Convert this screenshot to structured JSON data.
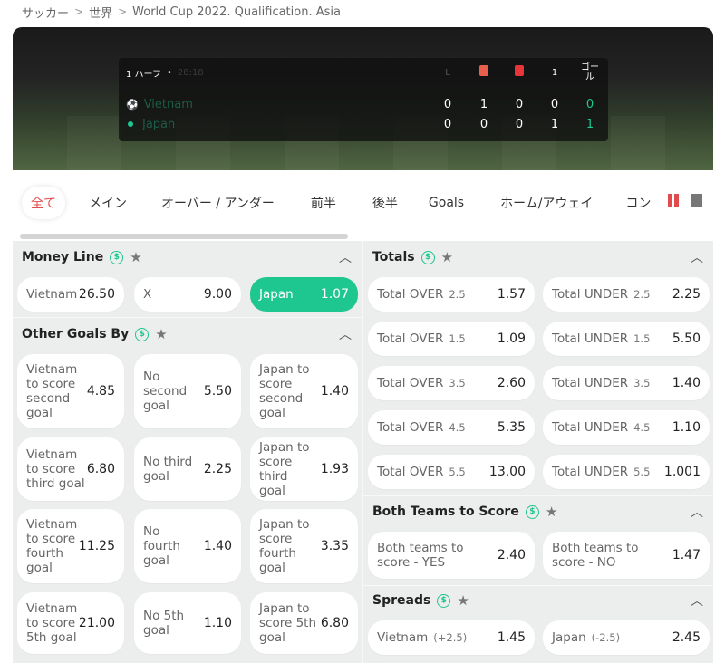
{
  "breadcrumb": [
    "サッカー",
    "世界",
    "World Cup 2022. Qualification. Asia"
  ],
  "scoreboard": {
    "period": "1 ハーフ",
    "time": "28:18",
    "headers": {
      "corners": "L",
      "goals_label": "ゴール",
      "col4": "1"
    },
    "teams": [
      {
        "name": "Vietnam",
        "values": [
          "0",
          "1",
          "0",
          "0"
        ],
        "goals": "0"
      },
      {
        "name": "Japan",
        "values": [
          "0",
          "0",
          "0",
          "1"
        ],
        "goals": "1"
      }
    ]
  },
  "tabs": [
    "全て",
    "メイン",
    "オーバー / アンダー",
    "前半",
    "後半",
    "Goals",
    "ホーム/アウェイ",
    "コン"
  ],
  "money_line": {
    "title": "Money Line",
    "options": [
      {
        "label": "Vietnam",
        "odds": "26.50"
      },
      {
        "label": "X",
        "odds": "9.00"
      },
      {
        "label": "Japan",
        "odds": "1.07"
      }
    ]
  },
  "other_goals": {
    "title": "Other Goals By",
    "rows": [
      [
        {
          "label": "Vietnam to score second goal",
          "odds": "4.85"
        },
        {
          "label": "No second goal",
          "odds": "5.50"
        },
        {
          "label": "Japan to score second goal",
          "odds": "1.40"
        }
      ],
      [
        {
          "label": "Vietnam to score third goal",
          "odds": "6.80"
        },
        {
          "label": "No third goal",
          "odds": "2.25"
        },
        {
          "label": "Japan to score third goal",
          "odds": "1.93"
        }
      ],
      [
        {
          "label": "Vietnam to score fourth goal",
          "odds": "11.25"
        },
        {
          "label": "No fourth goal",
          "odds": "1.40"
        },
        {
          "label": "Japan to score fourth goal",
          "odds": "3.35"
        }
      ],
      [
        {
          "label": "Vietnam to score 5th goal",
          "odds": "21.00"
        },
        {
          "label": "No 5th goal",
          "odds": "1.10"
        },
        {
          "label": "Japan to score 5th goal",
          "odds": "6.80"
        }
      ]
    ]
  },
  "totals": {
    "title": "Totals",
    "rows": [
      [
        {
          "label": "Total OVER",
          "line": "2.5",
          "odds": "1.57"
        },
        {
          "label": "Total UNDER",
          "line": "2.5",
          "odds": "2.25"
        }
      ],
      [
        {
          "label": "Total OVER",
          "line": "1.5",
          "odds": "1.09"
        },
        {
          "label": "Total UNDER",
          "line": "1.5",
          "odds": "5.50"
        }
      ],
      [
        {
          "label": "Total OVER",
          "line": "3.5",
          "odds": "2.60"
        },
        {
          "label": "Total UNDER",
          "line": "3.5",
          "odds": "1.40"
        }
      ],
      [
        {
          "label": "Total OVER",
          "line": "4.5",
          "odds": "5.35"
        },
        {
          "label": "Total UNDER",
          "line": "4.5",
          "odds": "1.10"
        }
      ],
      [
        {
          "label": "Total OVER",
          "line": "5.5",
          "odds": "13.00"
        },
        {
          "label": "Total UNDER",
          "line": "5.5",
          "odds": "1.001"
        }
      ]
    ]
  },
  "btts": {
    "title": "Both Teams to Score",
    "options": [
      {
        "label": "Both teams to score - YES",
        "odds": "2.40"
      },
      {
        "label": "Both teams to score - NO",
        "odds": "1.47"
      }
    ]
  },
  "spreads": {
    "title": "Spreads",
    "options": [
      {
        "label": "Vietnam",
        "line": "(+2.5)",
        "odds": "1.45"
      },
      {
        "label": "Japan",
        "line": "(-2.5)",
        "odds": "2.45"
      }
    ]
  },
  "colors": {
    "accent": "#1ec690",
    "active_tab": "#e14b4b"
  }
}
